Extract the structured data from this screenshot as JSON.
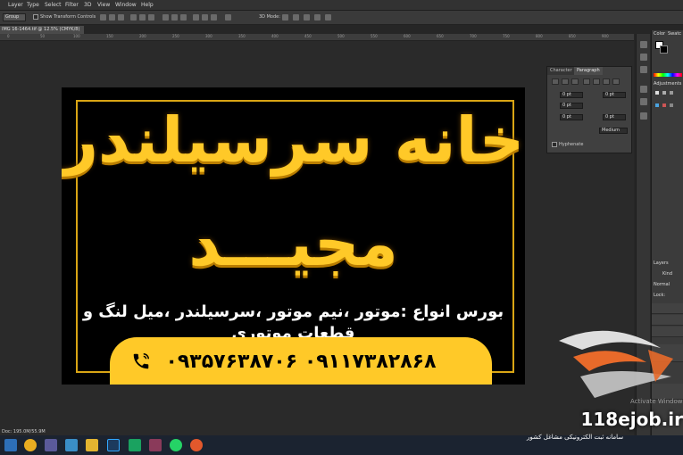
{
  "menu": {
    "items": [
      "Layer",
      "Type",
      "Select",
      "Filter",
      "3D",
      "View",
      "Window",
      "Help"
    ]
  },
  "options": {
    "group_select": "Group",
    "show_transform_label": "Show Transform Controls",
    "mode_label": "3D Mode:"
  },
  "document": {
    "tab_title": "IMG 16-1464.tif @ 12.5% (CMYK/8) ×",
    "status": "Doc: 195.0M/55.9M"
  },
  "ruler": {
    "ticks": [
      "0",
      "50",
      "100",
      "150",
      "200",
      "250",
      "300",
      "350",
      "400",
      "450",
      "500",
      "550",
      "600",
      "650",
      "700",
      "750",
      "800",
      "850",
      "900"
    ]
  },
  "card": {
    "title_line1": "خانه سرسیلندر",
    "title_line2": "مجیـــد",
    "subtitle": "بورس انواع :موتور ،نیم موتور ،سرسیلندر ،میل لنگ و قطعات موتوری",
    "phones": "۰۹۳۵۷۶۳۸۷۰۶     ۰۹۱۱۷۳۸۲۸۶۸",
    "colors": {
      "accent": "#ffc928",
      "background": "#000000"
    }
  },
  "paragraph_panel": {
    "tab_character": "Character",
    "tab_paragraph": "Paragraph",
    "fields": [
      "0 pt",
      "0 pt",
      "0 pt",
      "0 pt",
      "0 pt"
    ],
    "spacing_select": "Medium",
    "hyphenate_label": "Hyphenate"
  },
  "right_panels": {
    "color_tab": "Color",
    "swatches_tab": "Swatc",
    "adjustments_title": "Adjustments",
    "layers_tab": "Layers",
    "kind_label": "Kind",
    "blend_mode": "Normal",
    "lock_label": "Lock:"
  },
  "watermark": {
    "site": "118ejob.ir",
    "subtitle": "سامانه ثبت الکترونیکی مشاغل کشور",
    "activate": "Activate Windows"
  }
}
